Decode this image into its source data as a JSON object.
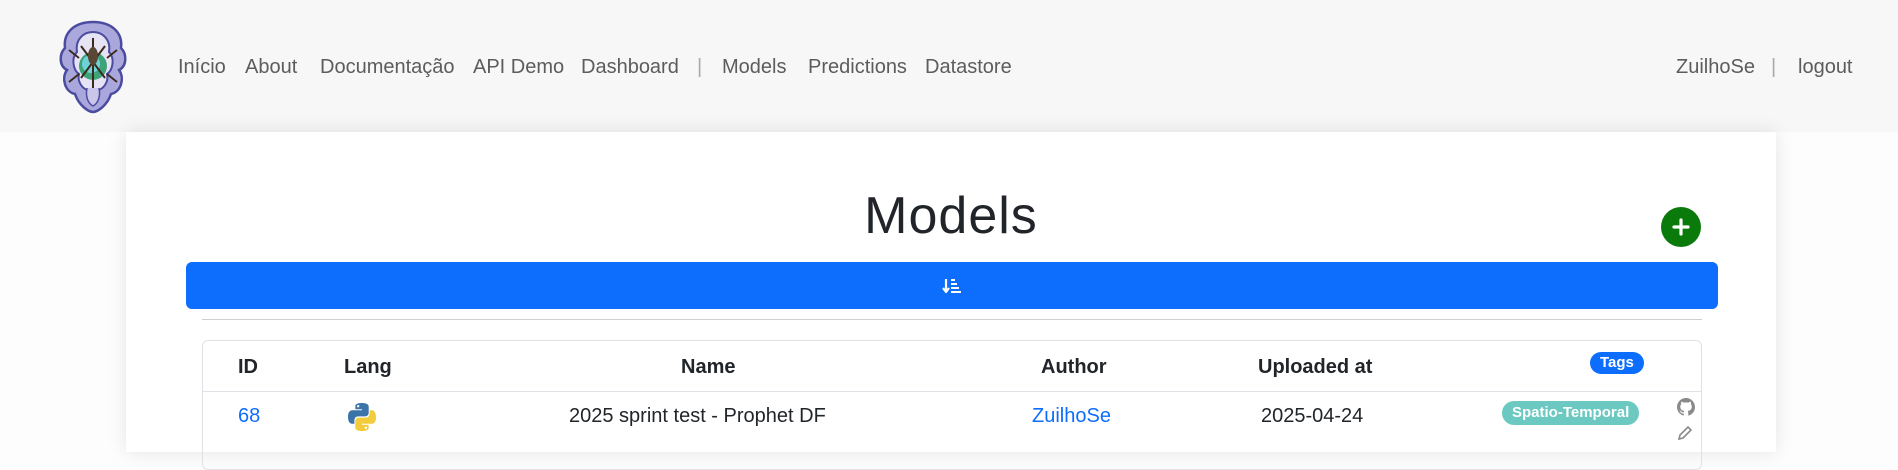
{
  "nav": {
    "links": [
      "Início",
      "About",
      "Documentação",
      "API Demo",
      "Dashboard"
    ],
    "separator": "|",
    "section_links": [
      "Models",
      "Predictions",
      "Datastore"
    ],
    "user": "ZuilhoSe",
    "logout": "logout"
  },
  "page": {
    "title": "Models",
    "add_icon": "plus-icon",
    "sort_icon": "sort-amount-down-icon"
  },
  "table": {
    "headers": {
      "id": "ID",
      "lang": "Lang",
      "name": "Name",
      "author": "Author",
      "uploaded": "Uploaded at",
      "tags": "Tags"
    },
    "rows": [
      {
        "id": "68",
        "lang_icon": "python-icon",
        "name": "2025 sprint test - Prophet DF",
        "author": "ZuilhoSe",
        "uploaded": "2025-04-24",
        "tag": "Spatio-Temporal"
      }
    ]
  },
  "colors": {
    "primary": "#0d6efd",
    "success": "#0a7a0a",
    "tag": "#6cc9c1"
  }
}
